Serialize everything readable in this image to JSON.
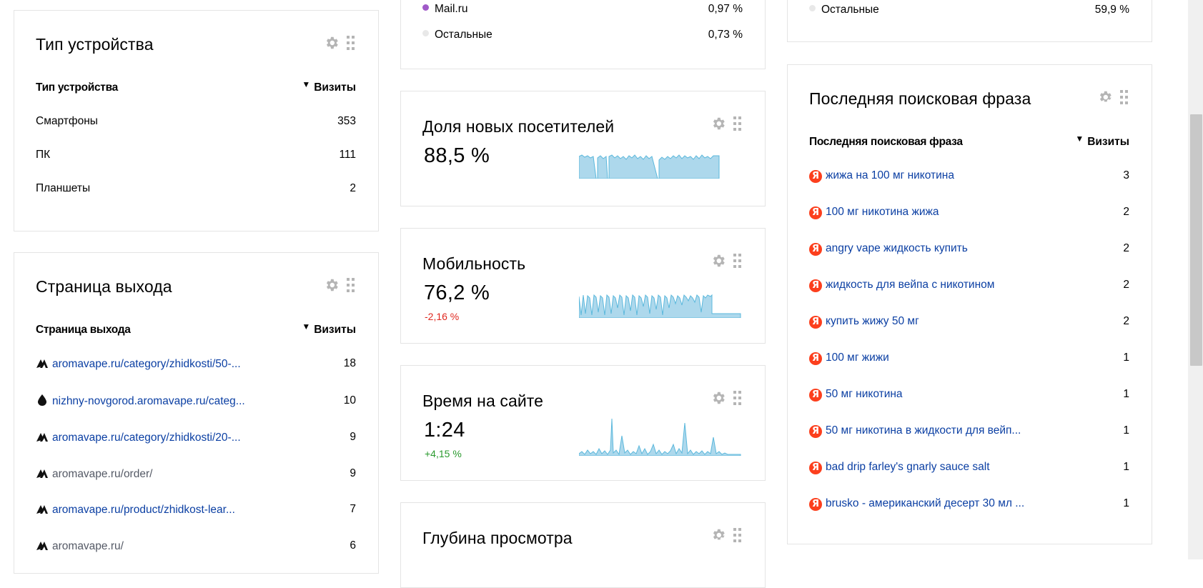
{
  "device_widget": {
    "title": "Тип устройства",
    "col_label": "Тип устройства",
    "col_value": "Визиты",
    "rows": [
      {
        "label": "Смартфоны",
        "value": "353"
      },
      {
        "label": "ПК",
        "value": "111"
      },
      {
        "label": "Планшеты",
        "value": "2"
      }
    ]
  },
  "exit_widget": {
    "title": "Страница выхода",
    "col_label": "Страница выхода",
    "col_value": "Визиты",
    "rows": [
      {
        "label": "aromavape.ru/category/zhidkosti/50-...",
        "value": "18",
        "icon": "aromavape-logo-icon"
      },
      {
        "label": "nizhny-novgorod.aromavape.ru/categ...",
        "value": "10",
        "icon": "drop-icon"
      },
      {
        "label": "aromavape.ru/category/zhidkosti/20-...",
        "value": "9",
        "icon": "aromavape-logo-icon"
      },
      {
        "label": "aromavape.ru/order/",
        "value": "9",
        "icon": "aromavape-logo-icon"
      },
      {
        "label": "aromavape.ru/product/zhidkost-lear...",
        "value": "7",
        "icon": "aromavape-logo-icon"
      },
      {
        "label": "aromavape.ru/",
        "value": "6",
        "icon": "aromavape-logo-icon"
      }
    ]
  },
  "browsers_partial": {
    "rows": [
      {
        "label": "Mail.ru",
        "value": "0,97 %",
        "color": "#a05ac8"
      },
      {
        "label": "Остальные",
        "value": "0,73 %",
        "color": "#e8e8e8"
      }
    ]
  },
  "new_visitors": {
    "title": "Доля новых посетителей",
    "value": "88,5 %"
  },
  "mobility": {
    "title": "Мобильность",
    "value": "76,2 %",
    "delta": "-2,16 %",
    "delta_color": "#e0281f"
  },
  "time_on_site": {
    "title": "Время на сайте",
    "value": "1:24",
    "delta": "+4,15 %",
    "delta_color": "#2a9a2e"
  },
  "depth": {
    "title": "Глубина просмотра"
  },
  "right_partial": {
    "rows": [
      {
        "label": "Остальные",
        "value": "59,9 %",
        "color": "#e8e8e8"
      }
    ]
  },
  "search_widget": {
    "title": "Последняя поисковая фраза",
    "col_label": "Последняя поисковая фраза",
    "col_value": "Визиты",
    "rows": [
      {
        "label": "жижа на 100 мг никотина",
        "value": "3"
      },
      {
        "label": "100 мг никотина жижа",
        "value": "2"
      },
      {
        "label": "angry vape жидкость купить",
        "value": "2"
      },
      {
        "label": "жидкость для вейпа с никотином",
        "value": "2"
      },
      {
        "label": "купить жижу 50 мг",
        "value": "2"
      },
      {
        "label": "100 мг жижи",
        "value": "1"
      },
      {
        "label": "50 мг никотина",
        "value": "1"
      },
      {
        "label": "50 мг никотина в жидкости для вейп...",
        "value": "1"
      },
      {
        "label": "bad drip farley's gnarly sauce salt",
        "value": "1"
      },
      {
        "label": "brusko - американский десерт 30 мл ...",
        "value": "1"
      }
    ]
  },
  "colors": {
    "link": "#0b3fa3",
    "spark_stroke": "#5bb8dc",
    "spark_fill": "#add8ec",
    "yandex_red": "#fc3f1d"
  }
}
